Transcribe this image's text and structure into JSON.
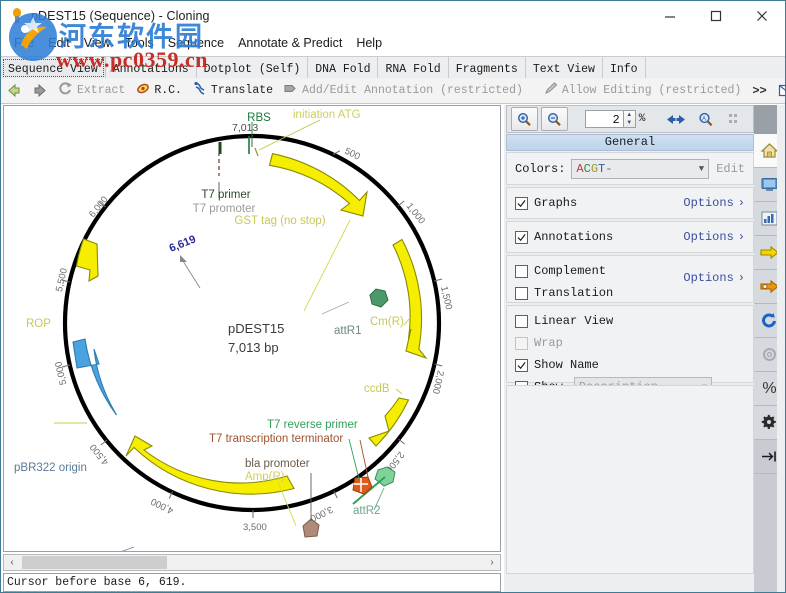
{
  "window": {
    "title": "pDEST15 (Sequence) - Cloning",
    "icon": "lightbulb-icon",
    "minimize": "minimize",
    "maximize": "maximize",
    "close": "close"
  },
  "watermark": {
    "line1": "河东软件园",
    "line2": "www.pc0359.cn"
  },
  "menubar": {
    "items": [
      {
        "label": "File"
      },
      {
        "label": "Edit"
      },
      {
        "label": "View"
      },
      {
        "label": "Tools"
      },
      {
        "label": "Sequence"
      },
      {
        "label": "Annotate & Predict"
      },
      {
        "label": "Help"
      }
    ]
  },
  "tabs": [
    {
      "label": "Sequence View",
      "active": true
    },
    {
      "label": "Annotations",
      "active": false
    },
    {
      "label": "Dotplot (Self)",
      "active": false
    },
    {
      "label": "DNA Fold",
      "active": false
    },
    {
      "label": "RNA Fold",
      "active": false
    },
    {
      "label": "Fragments",
      "active": false
    },
    {
      "label": "Text View",
      "active": false
    },
    {
      "label": "Info",
      "active": false
    }
  ],
  "toolbar": {
    "back_icon": "back-arrow-icon",
    "forward_icon": "forward-arrow-icon",
    "extract_label": "Extract",
    "extract_icon": "extract-icon",
    "rc_label": "R.C.",
    "rc_icon": "reverse-complement-icon",
    "translate_label": "Translate",
    "translate_icon": "translate-icon",
    "annotation_label": "Add/Edit Annotation (restricted)",
    "annotation_icon": "annotation-icon",
    "allow_editing_label": "Allow Editing (restricted)",
    "pencil_icon": "pencil-icon",
    "overflow_label": ">>",
    "mail_icon": "mail-icon",
    "split_icon": "split-view-icon"
  },
  "zoombar": {
    "zoom_in_icon": "zoom-in-icon",
    "zoom_out_icon": "zoom-out-icon",
    "zoom_value": "2",
    "zoom_unit": "%",
    "fit_icon": "fit-to-width-icon",
    "zoom_selection_icon": "zoom-to-selection-icon",
    "zoom_reset_icon": "zoom-reset-icon"
  },
  "panel": {
    "header": "General",
    "colors": {
      "label": "Colors:",
      "value": "ACGT-",
      "value_parts": [
        "A",
        "C",
        "G",
        "T",
        "-"
      ],
      "edit_label": "Edit"
    },
    "rows": [
      {
        "label": "Graphs",
        "checked": true,
        "options": "Options",
        "enabled": true
      },
      {
        "label": "Annotations",
        "checked": true,
        "options": "Options",
        "enabled": true
      },
      {
        "label": "Complement",
        "checked": false,
        "enabled": true
      },
      {
        "label": "Translation",
        "checked": false,
        "enabled": true
      },
      {
        "label": "Linear View",
        "checked": false,
        "enabled": true
      },
      {
        "label": "Wrap",
        "checked": false,
        "enabled": false
      },
      {
        "label": "Show Name",
        "checked": true,
        "enabled": true
      },
      {
        "label": "Show",
        "checked": false,
        "enabled": true
      }
    ],
    "complement_options": "Options",
    "description_placeholder": "Description",
    "rail_icons": [
      "home-icon",
      "monitor-icon",
      "bar-chart-icon",
      "yellow-arrow-icon",
      "orange-arrow-icon",
      "refresh-icon",
      "gear-disabled-icon",
      "percent-icon",
      "settings-gear-icon",
      "collapse-panel-icon"
    ]
  },
  "statusbar": {
    "text": "Cursor before base 6, 619."
  },
  "scrollbar": {
    "left_arrow": "‹",
    "right_arrow": "›"
  },
  "plasmid": {
    "name": "pDEST15",
    "length": "7,013 bp",
    "cursor_position_label": "6,619",
    "origin_label": "7,013",
    "tick_labels": [
      "500",
      "1,000",
      "1,500",
      "2,000",
      "2,500",
      "3,000",
      "3,500",
      "4,000",
      "4,500",
      "5,000",
      "5,500",
      "6,000"
    ],
    "features": [
      {
        "name": "RBS",
        "color": "#1a7a3c",
        "type": "marker"
      },
      {
        "name": "initiation ATG",
        "color": "#c8c83c",
        "type": "marker"
      },
      {
        "name": "T7 primer",
        "color": "#2a5a2a",
        "type": "primer"
      },
      {
        "name": "T7 promoter",
        "color": "#9a9a9a",
        "type": "promoter"
      },
      {
        "name": "GST tag (no stop)",
        "color": "#c8c83c",
        "type": "cds"
      },
      {
        "name": "attR1",
        "color": "#4a9a6a",
        "type": "site"
      },
      {
        "name": "Cm(R)",
        "color": "#d6d639",
        "type": "cds"
      },
      {
        "name": "ccdB",
        "color": "#d6d639",
        "type": "cds"
      },
      {
        "name": "attR2",
        "color": "#4a9a6a",
        "type": "site"
      },
      {
        "name": "T7 reverse primer",
        "color": "#2a8a4a",
        "type": "primer"
      },
      {
        "name": "T7 transcription terminator",
        "color": "#a0522d",
        "type": "terminator"
      },
      {
        "name": "bla promoter",
        "color": "#8a7a6a",
        "type": "promoter"
      },
      {
        "name": "Amp(R)",
        "color": "#d6d639",
        "type": "cds"
      },
      {
        "name": "pBR322 origin",
        "color": "#4a8ac8",
        "type": "origin"
      },
      {
        "name": "ROP",
        "color": "#d6d639",
        "type": "cds"
      }
    ]
  }
}
